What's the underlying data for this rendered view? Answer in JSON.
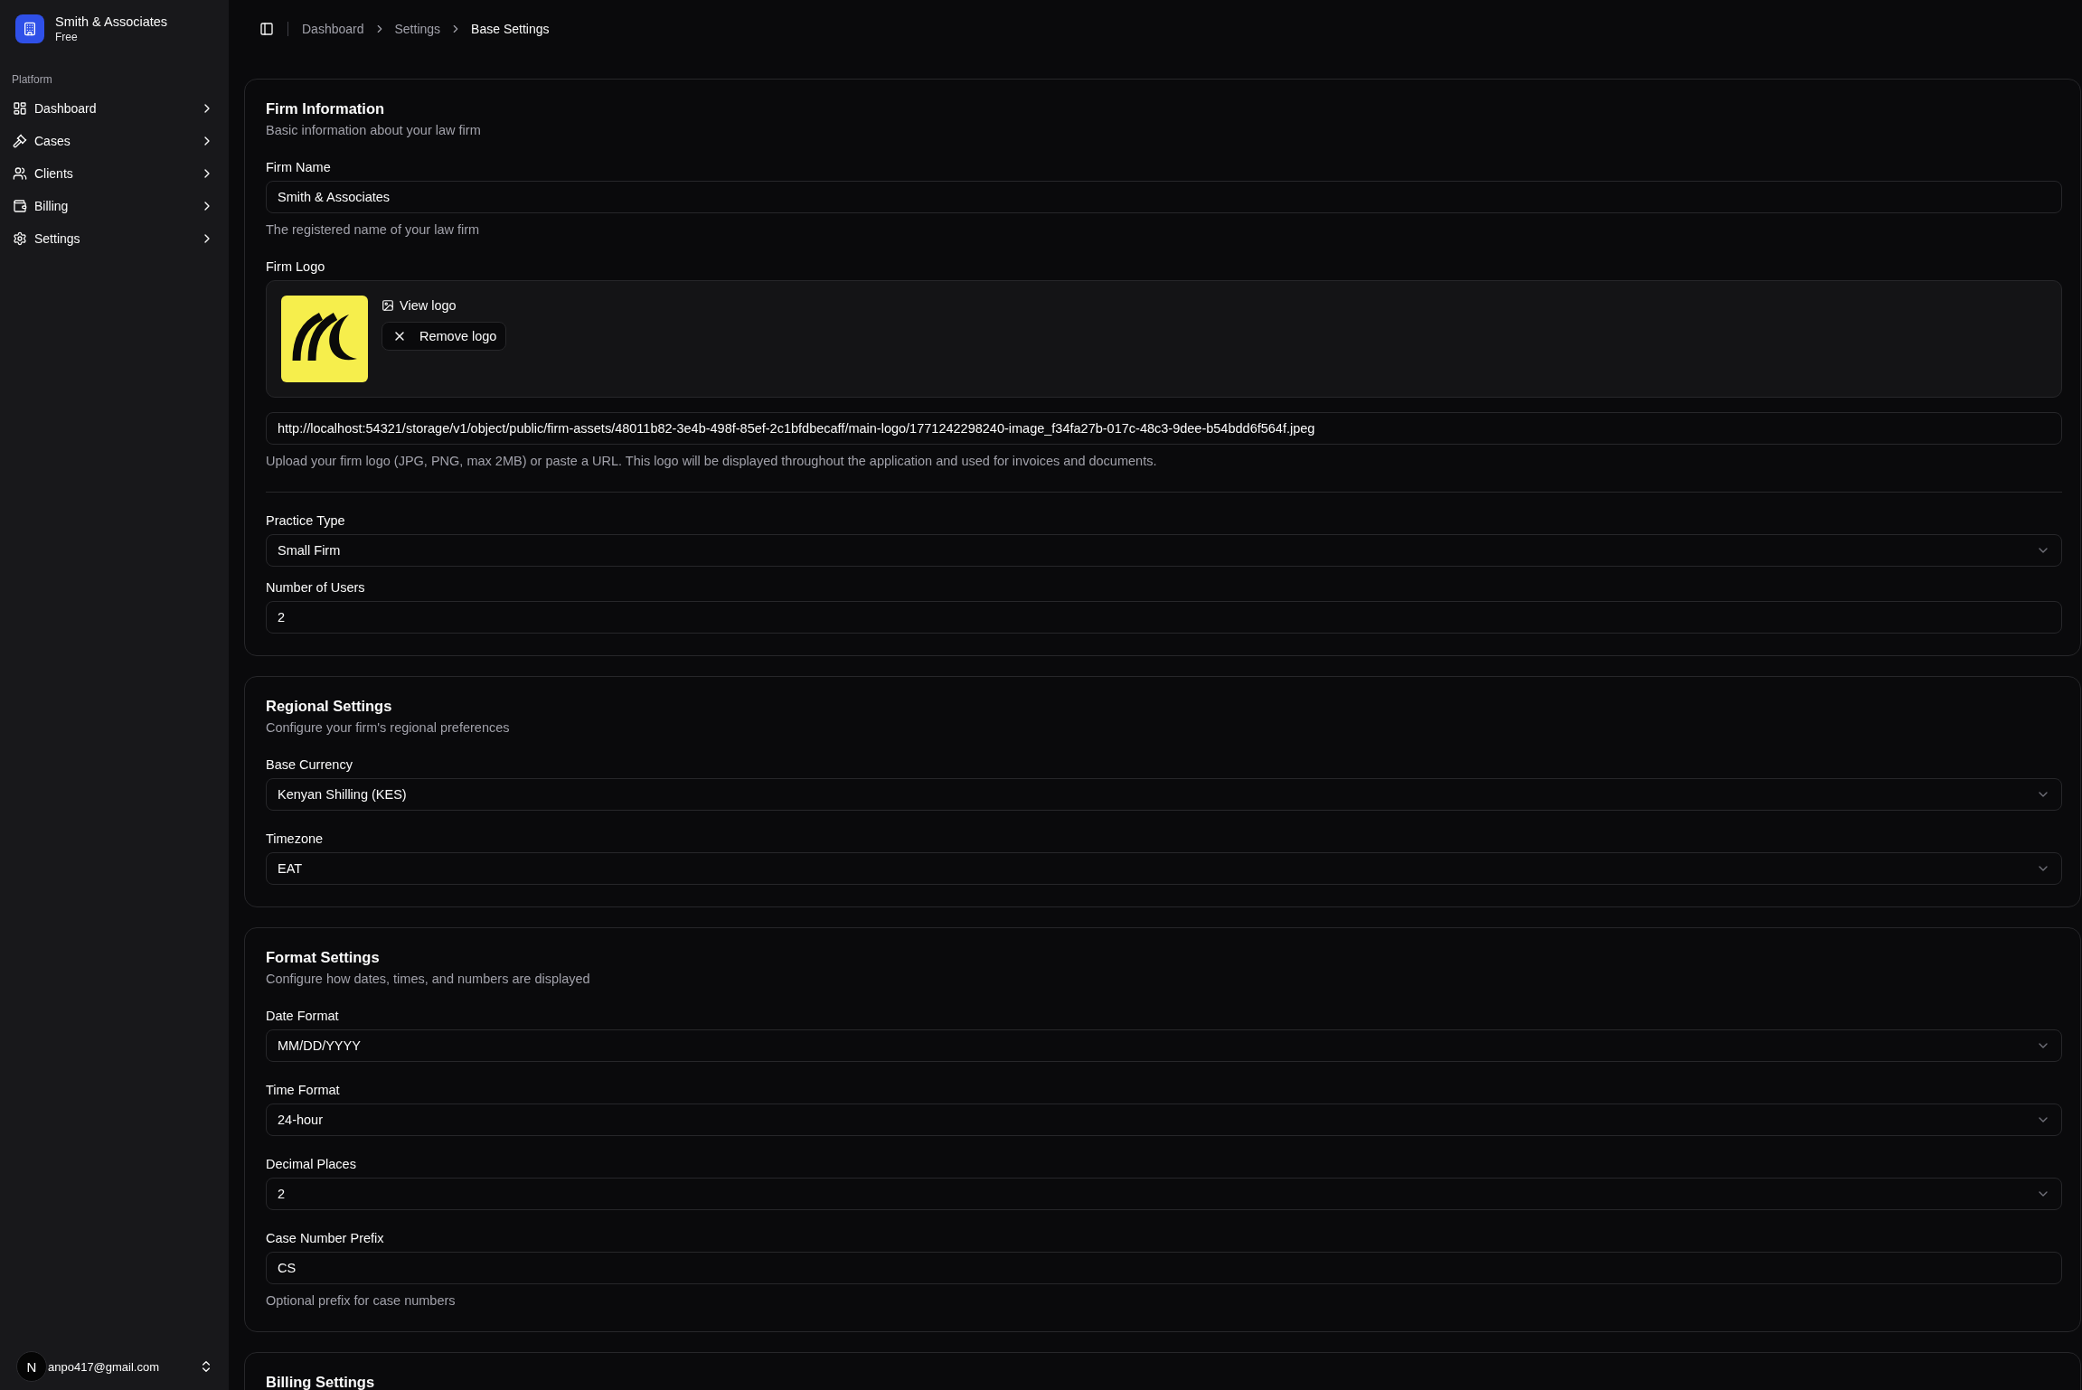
{
  "sidebar": {
    "team": {
      "name": "Smith & Associates",
      "plan": "Free"
    },
    "group_label": "Platform",
    "items": [
      {
        "label": "Dashboard",
        "expanded": false
      },
      {
        "label": "Cases",
        "expanded": false
      },
      {
        "label": "Clients",
        "expanded": false
      },
      {
        "label": "Billing",
        "expanded": false
      },
      {
        "label": "Settings",
        "expanded": false
      }
    ],
    "user": {
      "initial": "N",
      "email": "anpo417@gmail.com"
    }
  },
  "breadcrumb": [
    {
      "label": "Dashboard",
      "current": false
    },
    {
      "label": "Settings",
      "current": false
    },
    {
      "label": "Base Settings",
      "current": true
    }
  ],
  "sections": [
    {
      "title": "Firm Information",
      "description": "Basic information about your law firm",
      "fields": [
        {
          "kind": "input",
          "label": "Firm Name",
          "value": "Smith & Associates",
          "help": "The registered name of your law firm"
        },
        {
          "kind": "logo",
          "label": "Firm Logo",
          "view_label": "View logo",
          "remove_label": "Remove logo",
          "value": "http://localhost:54321/storage/v1/object/public/firm-assets/48011b82-3e4b-498f-85ef-2c1bfdbecaff/main-logo/1771242298240-image_f34fa27b-017c-48c3-9dee-b54bdd6f564f.jpeg",
          "help": "Upload your firm logo (JPG, PNG, max 2MB) or paste a URL. This logo will be displayed throughout the application and used for invoices and documents."
        },
        {
          "kind": "divider"
        },
        {
          "kind": "select",
          "label": "Practice Type",
          "value": "Small Firm"
        },
        {
          "kind": "input",
          "label": "Number of Users",
          "value": "2"
        }
      ]
    },
    {
      "title": "Regional Settings",
      "description": "Configure your firm's regional preferences",
      "fields": [
        {
          "kind": "select",
          "label": "Base Currency",
          "value": "Kenyan Shilling (KES)"
        },
        {
          "kind": "select",
          "label": "Timezone",
          "value": "EAT"
        }
      ]
    },
    {
      "title": "Format Settings",
      "description": "Configure how dates, times, and numbers are displayed",
      "fields": [
        {
          "kind": "select",
          "label": "Date Format",
          "value": "MM/DD/YYYY"
        },
        {
          "kind": "select",
          "label": "Time Format",
          "value": "24-hour"
        },
        {
          "kind": "select",
          "label": "Decimal Places",
          "value": "2"
        },
        {
          "kind": "input",
          "label": "Case Number Prefix",
          "value": "CS",
          "help": "Optional prefix for case numbers"
        }
      ]
    },
    {
      "title": "Billing Settings"
    }
  ]
}
